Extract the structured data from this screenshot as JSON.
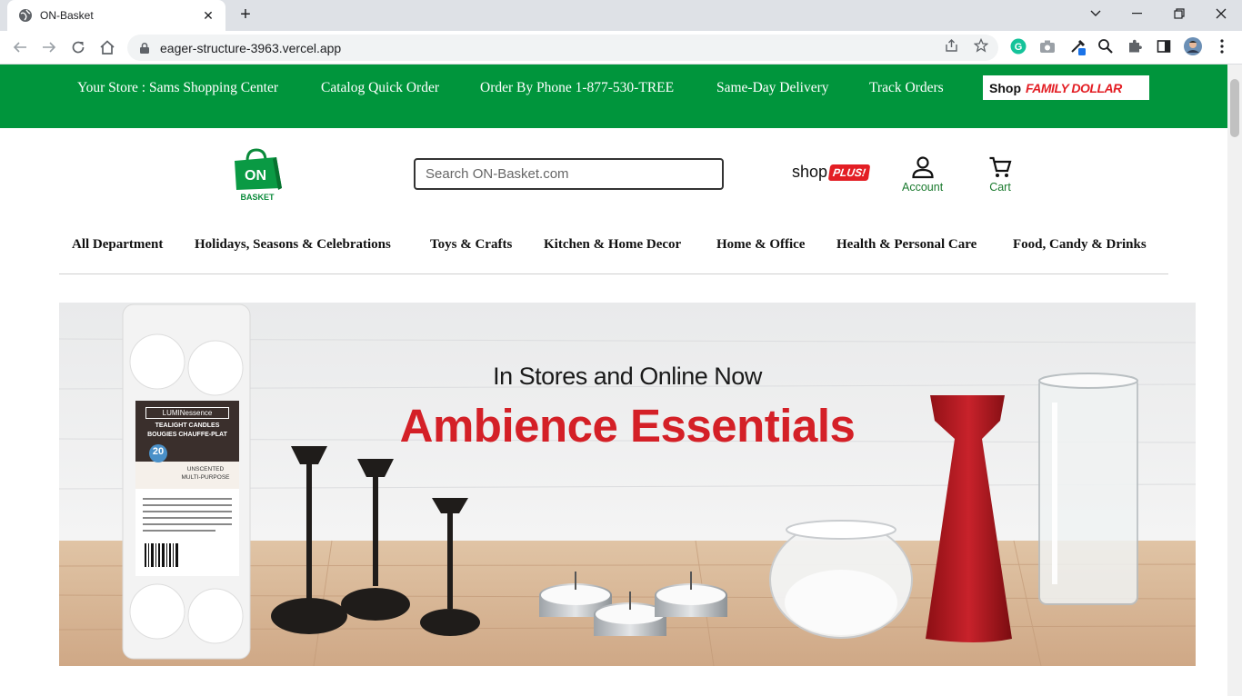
{
  "browser": {
    "tab_title": "ON-Basket",
    "url": "eager-structure-3963.vercel.app"
  },
  "topbar": {
    "store": "Your Store : Sams Shopping Center",
    "catalog": "Catalog Quick Order",
    "phone": "Order By Phone 1-877-530-TREE",
    "delivery": "Same-Day Delivery",
    "track": "Track Orders",
    "shop_word": "Shop",
    "family_dollar": "FAMILY DOLLAR"
  },
  "header": {
    "logo_text": "ON",
    "logo_sub": "BASKET",
    "search_placeholder": "Search ON-Basket.com",
    "shop_plus_word": "shop",
    "shop_plus_badge": "PLUS!",
    "account_label": "Account",
    "cart_label": "Cart"
  },
  "categories": [
    "All Department",
    "Holidays, Seasons & Celebrations",
    "Toys & Crafts",
    "Kitchen & Home Decor",
    "Home & Office",
    "Health & Personal Care",
    "Food, Candy & Drinks"
  ],
  "banner": {
    "subtitle": "In Stores and Online Now",
    "title": "Ambience Essentials",
    "package_brand": "LUMINessence",
    "package_line1": "TEALIGHT CANDLES",
    "package_line2": "BOUGIES CHAUFFE-PLAT",
    "package_count": "20",
    "package_desc1": "UNSCENTED",
    "package_desc2": "MULTI-PURPOSE"
  },
  "colors": {
    "brand_green": "#00953c",
    "accent_red": "#e31e24"
  }
}
